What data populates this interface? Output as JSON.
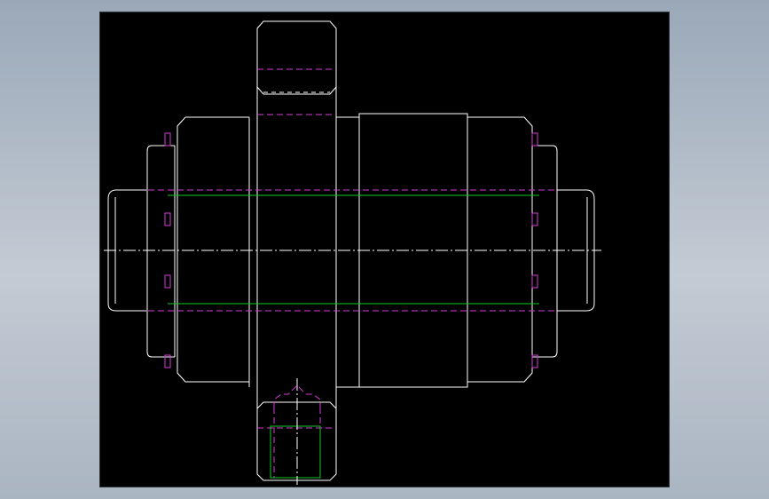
{
  "drawing": {
    "view": "front-elevation",
    "colors": {
      "background": "#000000",
      "outline": "#ffffff",
      "hidden_line": "#d63cd6",
      "pitch_line": "#16c826",
      "frame": "#9aa8b8"
    },
    "line_types": [
      "continuous",
      "hidden-dashed",
      "center-dash-dot"
    ]
  }
}
